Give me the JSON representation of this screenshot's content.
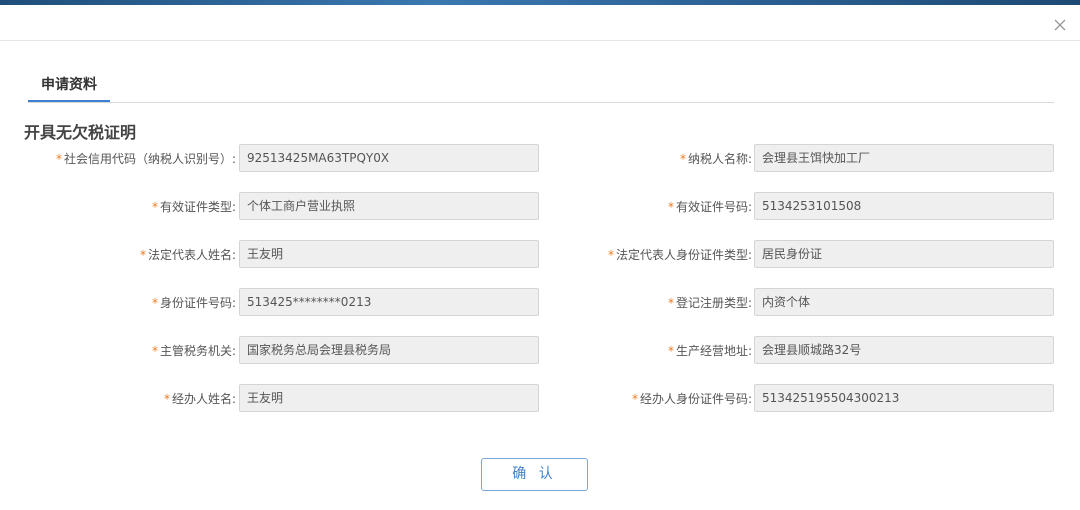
{
  "dialog": {
    "tab_label": "申请资料",
    "section_title": "开具无欠税证明",
    "confirm_label": "确 认"
  },
  "fields": {
    "credit_code": {
      "label": "社会信用代码（纳税人识别号）:",
      "value": "92513425MA63TPQY0X"
    },
    "taxpayer_name": {
      "label": "纳税人名称:",
      "value": "会理县王饵快加工厂"
    },
    "cert_type": {
      "label": "有效证件类型:",
      "value": "个体工商户营业执照"
    },
    "cert_number": {
      "label": "有效证件号码:",
      "value": "5134253101508"
    },
    "legal_rep_name": {
      "label": "法定代表人姓名:",
      "value": "王友明"
    },
    "legal_rep_id_type": {
      "label": "法定代表人身份证件类型:",
      "value": "居民身份证"
    },
    "id_number": {
      "label": "身份证件号码:",
      "value": "513425********0213"
    },
    "registration_type": {
      "label": "登记注册类型:",
      "value": "内资个体"
    },
    "tax_authority": {
      "label": "主管税务机关:",
      "value": "国家税务总局会理县税务局"
    },
    "business_address": {
      "label": "生产经营地址:",
      "value": "会理县顺城路32号"
    },
    "agent_name": {
      "label": "经办人姓名:",
      "value": "王友明"
    },
    "agent_id_number": {
      "label": "经办人身份证件号码:",
      "value": "513425195504300213"
    }
  },
  "required_marker": "*",
  "colors": {
    "accent": "#3d7fd0",
    "required": "#f07c1d",
    "field_bg": "#efefef"
  },
  "icons": {
    "close": "close-icon"
  }
}
